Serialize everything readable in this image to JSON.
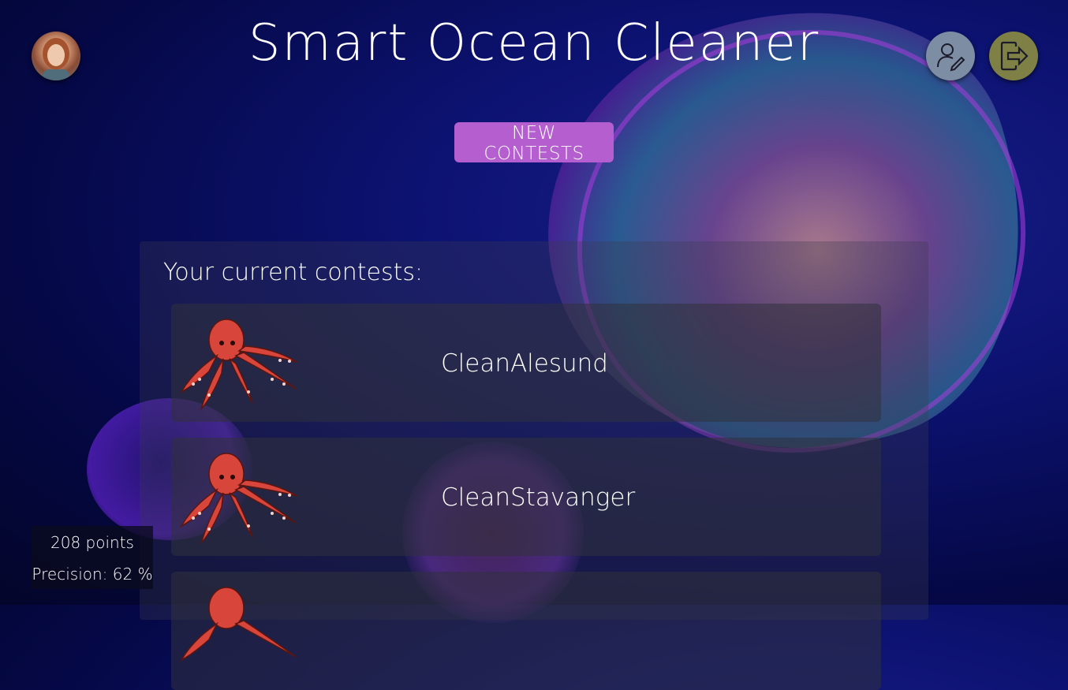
{
  "app": {
    "title": "Smart Ocean Cleaner"
  },
  "header": {
    "new_contests_label": "NEW CONTESTS",
    "icons": {
      "avatar": "user-avatar",
      "edit": "user-edit-icon",
      "logout": "logout-icon"
    }
  },
  "contests": {
    "heading": "Your current contests:",
    "items": [
      {
        "name": "CleanAlesund",
        "icon": "octopus-icon"
      },
      {
        "name": "CleanStavanger",
        "icon": "octopus-icon"
      },
      {
        "name": "",
        "icon": "octopus-icon"
      }
    ]
  },
  "stats": {
    "points": "208 points",
    "precision": "Precision: 62 %"
  },
  "colors": {
    "accent": "#b55ed0",
    "edit_button": "#7d8ea4",
    "logout_button": "#7f8045",
    "octopus": "#d8453b"
  }
}
